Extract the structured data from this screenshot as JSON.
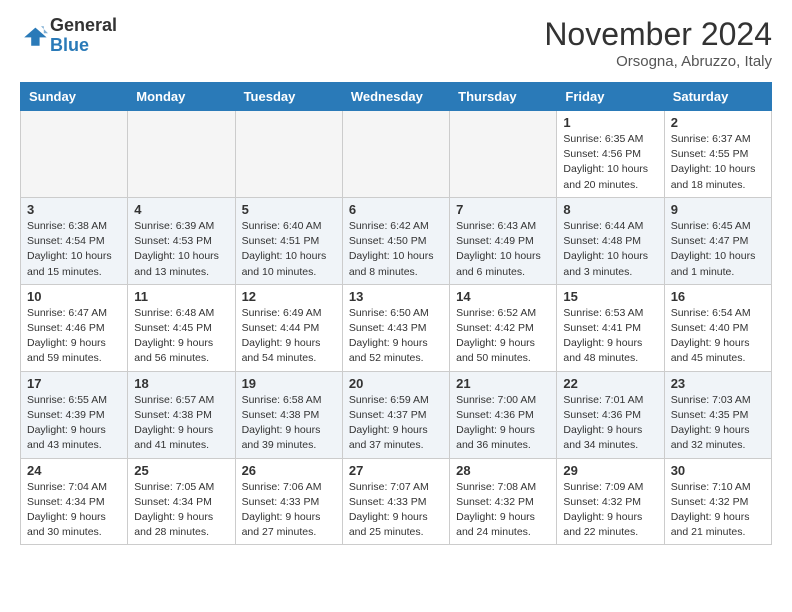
{
  "header": {
    "logo_line1": "General",
    "logo_line2": "Blue",
    "month": "November 2024",
    "location": "Orsogna, Abruzzo, Italy"
  },
  "weekdays": [
    "Sunday",
    "Monday",
    "Tuesday",
    "Wednesday",
    "Thursday",
    "Friday",
    "Saturday"
  ],
  "weeks": [
    [
      {
        "day": "",
        "info": ""
      },
      {
        "day": "",
        "info": ""
      },
      {
        "day": "",
        "info": ""
      },
      {
        "day": "",
        "info": ""
      },
      {
        "day": "",
        "info": ""
      },
      {
        "day": "1",
        "info": "Sunrise: 6:35 AM\nSunset: 4:56 PM\nDaylight: 10 hours and 20 minutes."
      },
      {
        "day": "2",
        "info": "Sunrise: 6:37 AM\nSunset: 4:55 PM\nDaylight: 10 hours and 18 minutes."
      }
    ],
    [
      {
        "day": "3",
        "info": "Sunrise: 6:38 AM\nSunset: 4:54 PM\nDaylight: 10 hours and 15 minutes."
      },
      {
        "day": "4",
        "info": "Sunrise: 6:39 AM\nSunset: 4:53 PM\nDaylight: 10 hours and 13 minutes."
      },
      {
        "day": "5",
        "info": "Sunrise: 6:40 AM\nSunset: 4:51 PM\nDaylight: 10 hours and 10 minutes."
      },
      {
        "day": "6",
        "info": "Sunrise: 6:42 AM\nSunset: 4:50 PM\nDaylight: 10 hours and 8 minutes."
      },
      {
        "day": "7",
        "info": "Sunrise: 6:43 AM\nSunset: 4:49 PM\nDaylight: 10 hours and 6 minutes."
      },
      {
        "day": "8",
        "info": "Sunrise: 6:44 AM\nSunset: 4:48 PM\nDaylight: 10 hours and 3 minutes."
      },
      {
        "day": "9",
        "info": "Sunrise: 6:45 AM\nSunset: 4:47 PM\nDaylight: 10 hours and 1 minute."
      }
    ],
    [
      {
        "day": "10",
        "info": "Sunrise: 6:47 AM\nSunset: 4:46 PM\nDaylight: 9 hours and 59 minutes."
      },
      {
        "day": "11",
        "info": "Sunrise: 6:48 AM\nSunset: 4:45 PM\nDaylight: 9 hours and 56 minutes."
      },
      {
        "day": "12",
        "info": "Sunrise: 6:49 AM\nSunset: 4:44 PM\nDaylight: 9 hours and 54 minutes."
      },
      {
        "day": "13",
        "info": "Sunrise: 6:50 AM\nSunset: 4:43 PM\nDaylight: 9 hours and 52 minutes."
      },
      {
        "day": "14",
        "info": "Sunrise: 6:52 AM\nSunset: 4:42 PM\nDaylight: 9 hours and 50 minutes."
      },
      {
        "day": "15",
        "info": "Sunrise: 6:53 AM\nSunset: 4:41 PM\nDaylight: 9 hours and 48 minutes."
      },
      {
        "day": "16",
        "info": "Sunrise: 6:54 AM\nSunset: 4:40 PM\nDaylight: 9 hours and 45 minutes."
      }
    ],
    [
      {
        "day": "17",
        "info": "Sunrise: 6:55 AM\nSunset: 4:39 PM\nDaylight: 9 hours and 43 minutes."
      },
      {
        "day": "18",
        "info": "Sunrise: 6:57 AM\nSunset: 4:38 PM\nDaylight: 9 hours and 41 minutes."
      },
      {
        "day": "19",
        "info": "Sunrise: 6:58 AM\nSunset: 4:38 PM\nDaylight: 9 hours and 39 minutes."
      },
      {
        "day": "20",
        "info": "Sunrise: 6:59 AM\nSunset: 4:37 PM\nDaylight: 9 hours and 37 minutes."
      },
      {
        "day": "21",
        "info": "Sunrise: 7:00 AM\nSunset: 4:36 PM\nDaylight: 9 hours and 36 minutes."
      },
      {
        "day": "22",
        "info": "Sunrise: 7:01 AM\nSunset: 4:36 PM\nDaylight: 9 hours and 34 minutes."
      },
      {
        "day": "23",
        "info": "Sunrise: 7:03 AM\nSunset: 4:35 PM\nDaylight: 9 hours and 32 minutes."
      }
    ],
    [
      {
        "day": "24",
        "info": "Sunrise: 7:04 AM\nSunset: 4:34 PM\nDaylight: 9 hours and 30 minutes."
      },
      {
        "day": "25",
        "info": "Sunrise: 7:05 AM\nSunset: 4:34 PM\nDaylight: 9 hours and 28 minutes."
      },
      {
        "day": "26",
        "info": "Sunrise: 7:06 AM\nSunset: 4:33 PM\nDaylight: 9 hours and 27 minutes."
      },
      {
        "day": "27",
        "info": "Sunrise: 7:07 AM\nSunset: 4:33 PM\nDaylight: 9 hours and 25 minutes."
      },
      {
        "day": "28",
        "info": "Sunrise: 7:08 AM\nSunset: 4:32 PM\nDaylight: 9 hours and 24 minutes."
      },
      {
        "day": "29",
        "info": "Sunrise: 7:09 AM\nSunset: 4:32 PM\nDaylight: 9 hours and 22 minutes."
      },
      {
        "day": "30",
        "info": "Sunrise: 7:10 AM\nSunset: 4:32 PM\nDaylight: 9 hours and 21 minutes."
      }
    ]
  ]
}
